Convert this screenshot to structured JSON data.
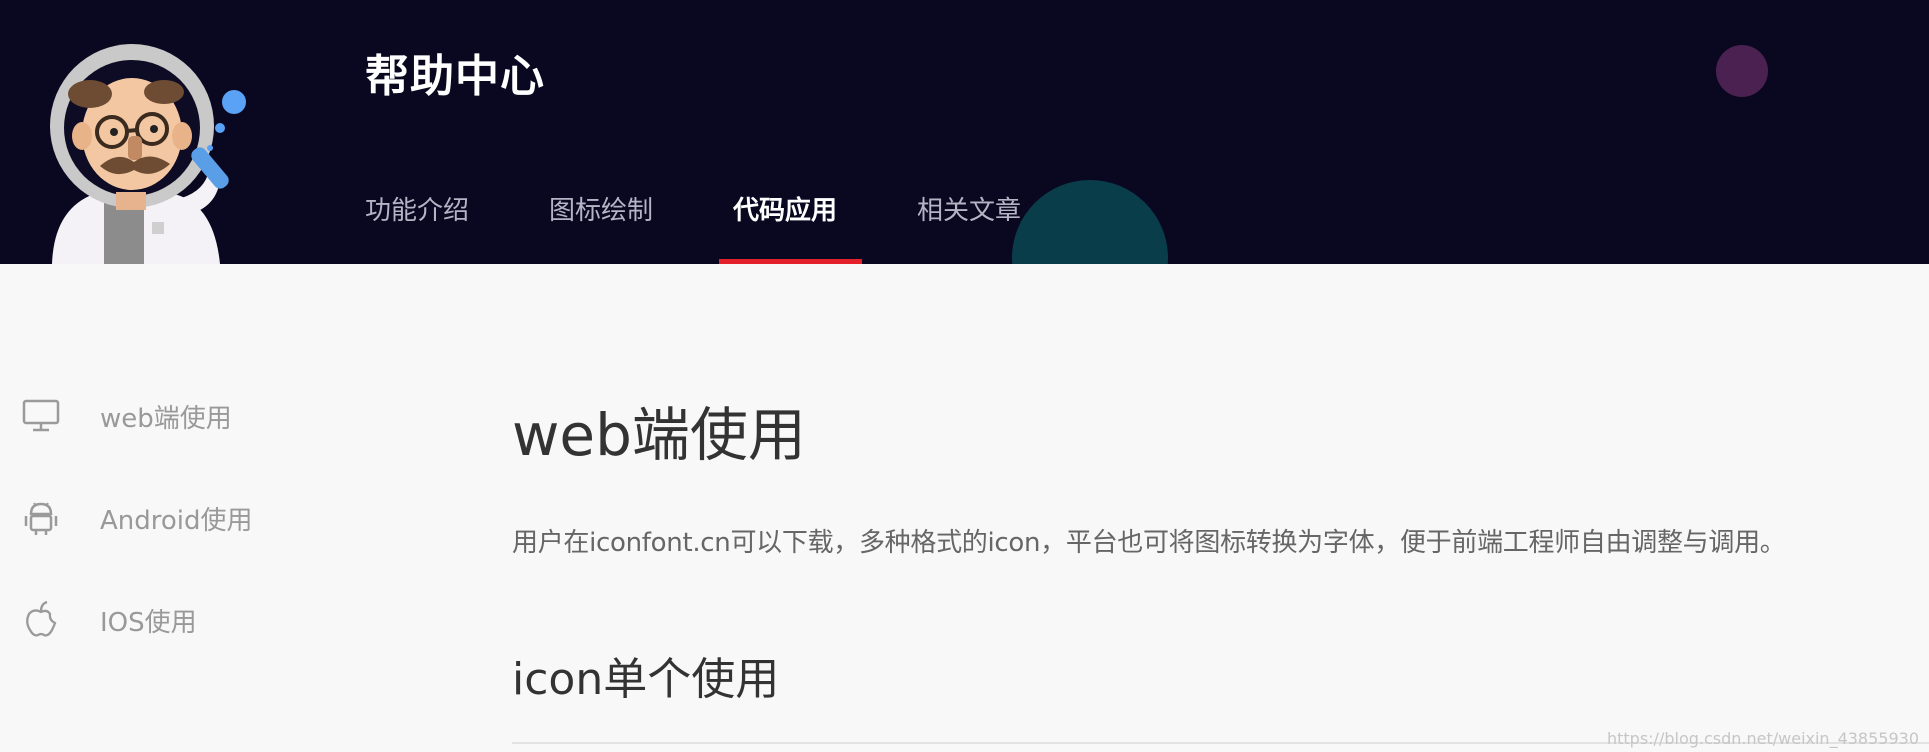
{
  "header": {
    "title": "帮助中心",
    "tabs": [
      {
        "label": "功能介绍",
        "active": false
      },
      {
        "label": "图标绘制",
        "active": false
      },
      {
        "label": "代码应用",
        "active": true
      },
      {
        "label": "相关文章",
        "active": false
      }
    ]
  },
  "sidebar": {
    "items": [
      {
        "label": "web端使用",
        "icon": "monitor-icon"
      },
      {
        "label": "Android使用",
        "icon": "android-icon"
      },
      {
        "label": "IOS使用",
        "icon": "apple-icon"
      }
    ]
  },
  "main": {
    "heading": "web端使用",
    "paragraph": "用户在iconfont.cn可以下载，多种格式的icon，平台也可将图标转换为字体，便于前端工程师自由调整与调用。",
    "subheading": "icon单个使用"
  },
  "watermark": "https://blog.csdn.net/weixin_43855930",
  "colors": {
    "header_bg": "#0a0821",
    "active_underline": "#e4202a",
    "page_bg": "#f8f8f8"
  }
}
